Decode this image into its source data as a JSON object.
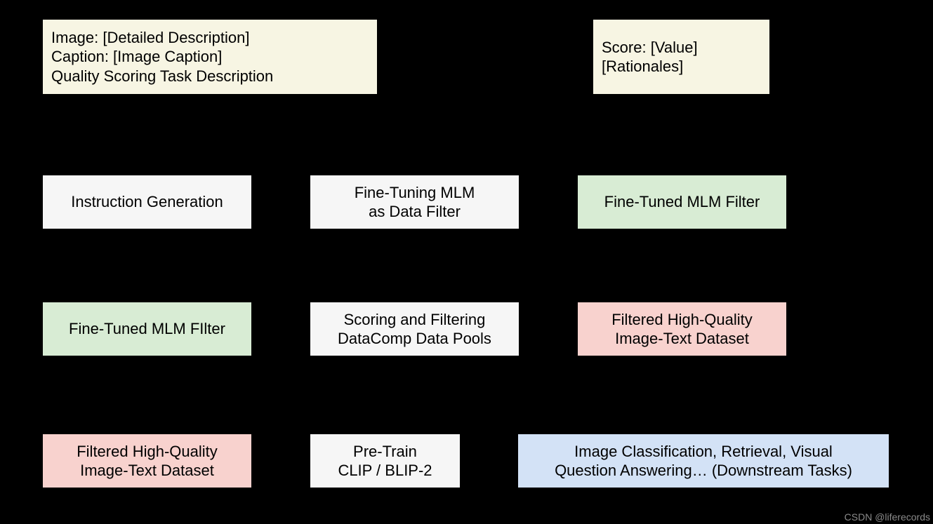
{
  "top": {
    "input": "Image: [Detailed Description]\nCaption: [Image Caption]\nQuality Scoring Task Description",
    "output": "Score: [Value]\n[Rationales]"
  },
  "row1": {
    "a": "Instruction Generation",
    "b": "Fine-Tuning MLM\nas Data Filter",
    "c": "Fine-Tuned MLM Filter"
  },
  "row2": {
    "a": "Fine-Tuned MLM FIlter",
    "b": "Scoring and Filtering\nDataComp Data Pools",
    "c": "Filtered High-Quality\nImage-Text Dataset"
  },
  "row3": {
    "a": "Filtered High-Quality\nImage-Text Dataset",
    "b": "Pre-Train\nCLIP / BLIP-2",
    "c": "Image Classification, Retrieval, Visual\nQuestion Answering… (Downstream Tasks)"
  },
  "watermark": "CSDN @liferecords",
  "colors": {
    "cream": "#f7f5e3",
    "grey": "#f6f6f6",
    "green": "#d8ecd4",
    "red": "#f8d2ce",
    "blue": "#d3e2f6"
  }
}
